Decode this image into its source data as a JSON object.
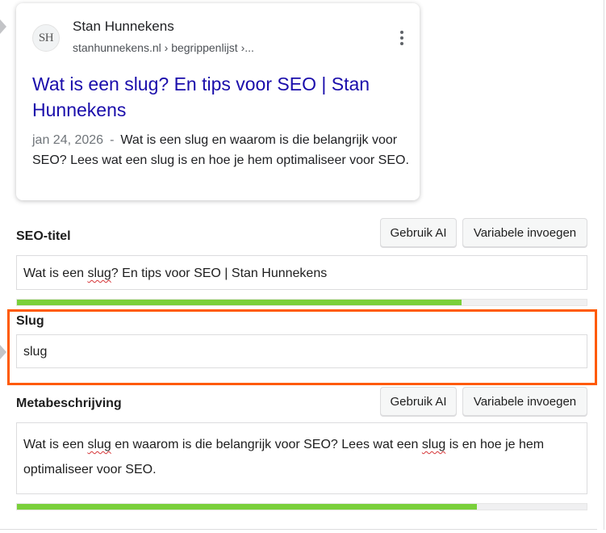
{
  "serp": {
    "favicon_text": "SH",
    "site_name": "Stan Hunnekens",
    "site_url": "stanhunnekens.nl › begrippenlijst ›...",
    "title": "Wat is een slug? En tips voor SEO | Stan Hunnekens",
    "date": "jan 24, 2026",
    "separator": "-",
    "description": "Wat is een slug en waarom is die belangrijk voor SEO? Lees wat een slug is en hoe je hem optimaliseer voor SEO."
  },
  "seo_title": {
    "label": "SEO-titel",
    "ai_button": "Gebruik AI",
    "variable_button": "Variabele invoegen",
    "value_before": "Wat is een ",
    "value_marked": "slug",
    "value_after": "? En tips voor SEO | Stan Hunnekens",
    "progress": 0.78
  },
  "slug": {
    "label": "Slug",
    "value": "slug"
  },
  "meta": {
    "label": "Metabeschrijving",
    "ai_button": "Gebruik AI",
    "variable_button": "Variabele invoegen",
    "value_1": "Wat is een ",
    "value_2": "slug",
    "value_3": " en waarom is die belangrijk voor SEO? Lees wat een ",
    "value_4": "slug",
    "value_5": " is en hoe je hem optimaliseer voor SEO.",
    "progress": 0.807
  },
  "colors": {
    "highlight": "#ff5a00",
    "progress_good": "#7ad03a",
    "serp_link": "#1a0dab"
  }
}
